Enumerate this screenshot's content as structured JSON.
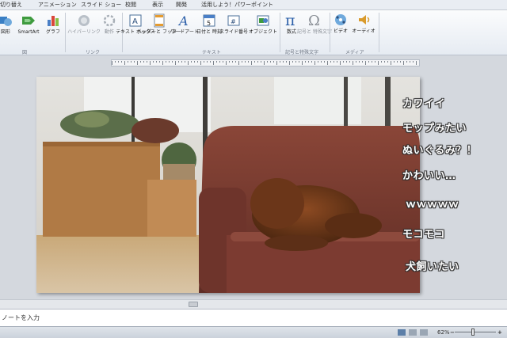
{
  "tabs": [
    "切り替え",
    "アニメーション",
    "スライド ショー",
    "校閲",
    "表示",
    "開発",
    "活用しよう！パワーポイント"
  ],
  "ribbon": {
    "buttons": [
      {
        "label": "図形",
        "icon": "shapes-icon"
      },
      {
        "label": "SmartArt",
        "icon": "smartart-icon"
      },
      {
        "label": "グラフ",
        "icon": "chart-icon"
      },
      {
        "label": "ハイパーリンク",
        "icon": "hyperlink-icon"
      },
      {
        "label": "動作",
        "icon": "action-icon"
      },
      {
        "label": "テキスト ボックス",
        "icon": "textbox-icon"
      },
      {
        "label": "ヘッダーと フッター",
        "icon": "header-footer-icon"
      },
      {
        "label": "ワードアート",
        "icon": "wordart-icon"
      },
      {
        "label": "日付と 時刻",
        "icon": "date-time-icon"
      },
      {
        "label": "スライド番号",
        "icon": "slide-number-icon"
      },
      {
        "label": "オブジェクト",
        "icon": "object-icon"
      },
      {
        "label": "数式",
        "icon": "equation-icon"
      },
      {
        "label": "記号と 特殊文字",
        "icon": "symbol-icon"
      },
      {
        "label": "ビデオ",
        "icon": "video-icon"
      },
      {
        "label": "オーディオ",
        "icon": "audio-icon"
      }
    ],
    "groups": [
      "図",
      "リンク",
      "テキスト",
      "記号と特殊文字",
      "メディア"
    ]
  },
  "slide": {
    "comments": [
      "カワイイ",
      "モップみたい",
      "ぬいぐるみ？！",
      "かわいい…",
      "ｗｗｗｗｗ",
      "モコモコ",
      "犬飼いたい"
    ]
  },
  "notes": {
    "placeholder": "ノートを入力"
  },
  "status": {
    "zoom": "62%"
  },
  "colors": {
    "comment_text": "#ffffff",
    "comment_outline": "#333333",
    "sofa": "#7a3a30"
  }
}
